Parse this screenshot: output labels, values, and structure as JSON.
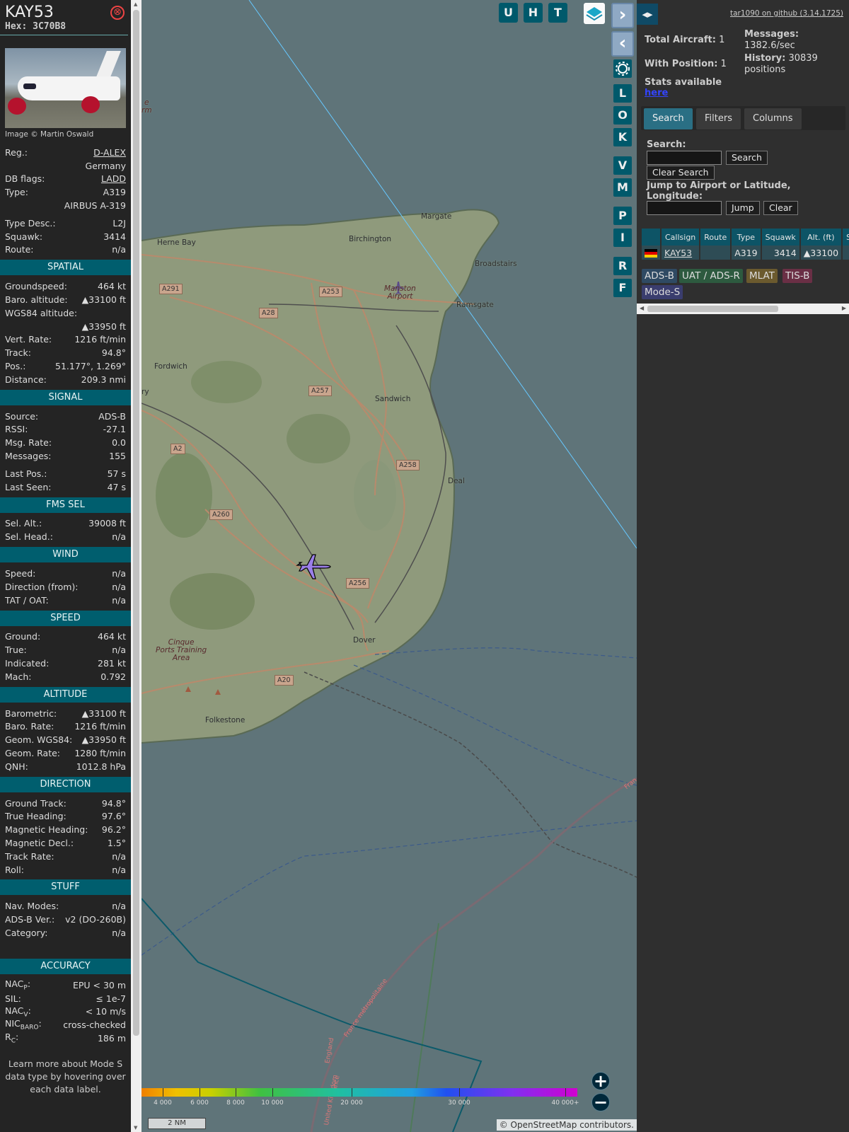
{
  "info": {
    "callsign": "KAY53",
    "hex_label": "Hex:",
    "hex": "3C70B8",
    "close_icon": "⊗",
    "photo_credit": "Image © Martin Oswald",
    "rows_top": [
      {
        "label": "Reg.:",
        "value": "D-ALEX",
        "link": true
      },
      {
        "label": "",
        "value": "Germany"
      },
      {
        "label": "DB flags:",
        "value": "LADD",
        "link": true
      },
      {
        "label": "Type:",
        "value": "A319"
      },
      {
        "label": "",
        "value": "AIRBUS A-319"
      },
      {
        "label": "Type Desc.:",
        "value": "L2J",
        "gap": true
      },
      {
        "label": "Squawk:",
        "value": "3414"
      },
      {
        "label": "Route:",
        "value": "n/a"
      }
    ],
    "sections": [
      {
        "title": "SPATIAL",
        "rows": [
          {
            "label": "Groundspeed:",
            "value": "464 kt"
          },
          {
            "label": "Baro. altitude:",
            "value": "▲33100 ft"
          },
          {
            "label": "WGS84 altitude:",
            "value": ""
          },
          {
            "label": "",
            "value": "▲33950 ft"
          },
          {
            "label": "Vert. Rate:",
            "value": "1216 ft/min"
          },
          {
            "label": "Track:",
            "value": "94.8°"
          },
          {
            "label": "Pos.:",
            "value": "51.177°, 1.269°"
          },
          {
            "label": "Distance:",
            "value": "209.3 nmi"
          }
        ]
      },
      {
        "title": "SIGNAL",
        "rows": [
          {
            "label": "Source:",
            "value": "ADS-B"
          },
          {
            "label": "RSSI:",
            "value": "-27.1"
          },
          {
            "label": "Msg. Rate:",
            "value": "0.0"
          },
          {
            "label": "Messages:",
            "value": "155"
          },
          {
            "label": "Last Pos.:",
            "value": "57 s",
            "gap": true
          },
          {
            "label": "Last Seen:",
            "value": "47 s"
          }
        ]
      },
      {
        "title": "FMS SEL",
        "rows": [
          {
            "label": "Sel. Alt.:",
            "value": "39008 ft"
          },
          {
            "label": "Sel. Head.:",
            "value": "n/a"
          }
        ]
      },
      {
        "title": "WIND",
        "rows": [
          {
            "label": "Speed:",
            "value": "n/a"
          },
          {
            "label": "Direction (from):",
            "value": "n/a"
          },
          {
            "label": "TAT / OAT:",
            "value": "n/a"
          }
        ]
      },
      {
        "title": "SPEED",
        "rows": [
          {
            "label": "Ground:",
            "value": "464 kt"
          },
          {
            "label": "True:",
            "value": "n/a"
          },
          {
            "label": "Indicated:",
            "value": "281 kt"
          },
          {
            "label": "Mach:",
            "value": "0.792"
          }
        ]
      },
      {
        "title": "ALTITUDE",
        "rows": [
          {
            "label": "Barometric:",
            "value": "▲33100 ft"
          },
          {
            "label": "Baro. Rate:",
            "value": "1216 ft/min"
          },
          {
            "label": "Geom. WGS84:",
            "value": "▲33950 ft"
          },
          {
            "label": "Geom. Rate:",
            "value": "1280 ft/min"
          },
          {
            "label": "QNH:",
            "value": "1012.8 hPa"
          }
        ]
      },
      {
        "title": "DIRECTION",
        "rows": [
          {
            "label": "Ground Track:",
            "value": "94.8°"
          },
          {
            "label": "True Heading:",
            "value": "97.6°"
          },
          {
            "label": "Magnetic Heading:",
            "value": "96.2°"
          },
          {
            "label": "Magnetic Decl.:",
            "value": "1.5°"
          },
          {
            "label": "Track Rate:",
            "value": "n/a"
          },
          {
            "label": "Roll:",
            "value": "n/a"
          }
        ]
      },
      {
        "title": "STUFF",
        "rows": [
          {
            "label": "Nav. Modes:",
            "value": "n/a"
          },
          {
            "label": "ADS-B Ver.:",
            "value": "v2 (DO-260B)"
          },
          {
            "label": "Category:",
            "value": "n/a"
          }
        ],
        "after_gap": true
      },
      {
        "title": "ACCURACY",
        "rows": [
          {
            "label": "NAC",
            "sub": "P",
            "label_end": ":",
            "value": "EPU < 30 m"
          },
          {
            "label": "SIL:",
            "value": "≤ 1e-7"
          },
          {
            "label": "NAC",
            "sub": "V",
            "label_end": ":",
            "value": "< 10 m/s"
          },
          {
            "label": "NIC",
            "sub": "BARO",
            "label_end": ":",
            "value": "cross-checked"
          },
          {
            "label": "R",
            "sub": "C",
            "label_end": ":",
            "value": "186 m"
          }
        ]
      }
    ],
    "learn_more": "Learn more about Mode S data type by hovering over each data label."
  },
  "map": {
    "top_buttons": [
      "U",
      "H",
      "T"
    ],
    "side_buttons": [
      "L",
      "O",
      "K",
      "V",
      "M",
      "P",
      "I",
      "R",
      "F"
    ],
    "places": [
      {
        "name": "Margate"
      },
      {
        "name": "Birchington"
      },
      {
        "name": "Herne Bay"
      },
      {
        "name": "Broadstairs"
      },
      {
        "name": "Manston\nAirport"
      },
      {
        "name": "Ramsgate"
      },
      {
        "name": "Fordwich"
      },
      {
        "name": "Sandwich"
      },
      {
        "name": "Deal"
      },
      {
        "name": "Dover"
      },
      {
        "name": "Folkestone"
      },
      {
        "name": "Cinque\nPorts Training\nArea"
      },
      {
        "name": "ry"
      },
      {
        "name": "e\nrm"
      }
    ],
    "roads": [
      "A291",
      "A253",
      "A28",
      "A257",
      "A2",
      "A258",
      "A260",
      "A256",
      "A20"
    ],
    "border_labels": [
      "France métropolitaine",
      "England",
      "United Kingdom",
      "France",
      "Fran"
    ],
    "legend_ticks": [
      "4 000",
      "6 000",
      "8 000",
      "10 000",
      "20 000",
      "30 000",
      "40 000+"
    ],
    "scale": "2 NM",
    "attribution": "© OpenStreetMap contributors.",
    "aircraft_color": "#9b7fe8"
  },
  "sidebar": {
    "toggle_icon": "◂▸",
    "github": "tar1090 on github (3.14.1725)",
    "total_aircraft_label": "Total Aircraft:",
    "total_aircraft": "1",
    "with_position_label": "With Position:",
    "with_position": "1",
    "messages_label": "Messages:",
    "messages": "1382.6/sec",
    "history_label": "History:",
    "history": "30839",
    "history_unit": "positions",
    "stats_label": "Stats available",
    "stats_link": "here",
    "tabs": [
      "Search",
      "Filters",
      "Columns"
    ],
    "search_label": "Search:",
    "search_button": "Search",
    "clear_search_button": "Clear Search",
    "jump_label": "Jump to Airport or Latitude, Longitude:",
    "jump_button": "Jump",
    "clear_button": "Clear",
    "table_headers": [
      "",
      "Callsign",
      "Route",
      "Type",
      "Squawk",
      "Alt. (ft)",
      "Spd"
    ],
    "table_rows": [
      {
        "callsign": "KAY53",
        "route": "",
        "type": "A319",
        "squawk": "3414",
        "alt": "▲33100",
        "spd": ""
      }
    ],
    "sources": [
      {
        "label": "ADS-B",
        "color": "#2f4a63"
      },
      {
        "label": "UAT / ADS-R",
        "color": "#2d5a3f"
      },
      {
        "label": "MLAT",
        "color": "#6b5a2e"
      },
      {
        "label": "TIS-B",
        "color": "#6a2f45"
      },
      {
        "label": "Mode-S",
        "color": "#3a3d6e"
      }
    ]
  }
}
